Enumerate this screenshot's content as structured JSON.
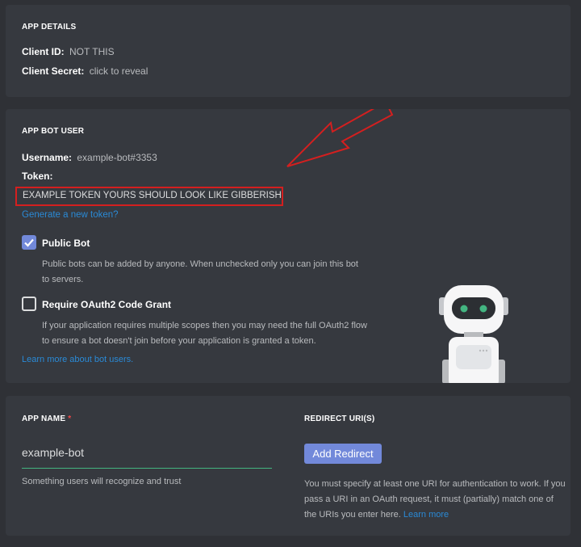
{
  "app_details": {
    "title": "APP DETAILS",
    "client_id_label": "Client ID:",
    "client_id_value": "NOT THIS",
    "client_secret_label": "Client Secret:",
    "client_secret_link": "click to reveal"
  },
  "bot_user": {
    "title": "APP BOT USER",
    "username_label": "Username:",
    "username_value": "example-bot#3353",
    "token_label": "Token:",
    "token_value": "EXAMPLE TOKEN YOURS SHOULD LOOK LIKE GIBBERISH",
    "new_token_link": "Generate a new token?",
    "public_bot": {
      "label": "Public Bot",
      "checked": true,
      "description": "Public bots can be added by anyone. When unchecked only you can join this bot to servers."
    },
    "oauth_grant": {
      "label": "Require OAuth2 Code Grant",
      "checked": false,
      "description": "If your application requires multiple scopes then you may need the full OAuth2 flow to ensure a bot doesn't join before your application is granted a token."
    },
    "learn_more_link": "Learn more about bot users.",
    "annotation_color": "#d41f1f"
  },
  "app_name": {
    "title": "APP NAME",
    "required_mark": "*",
    "value": "example-bot",
    "hint": "Something users will recognize and trust"
  },
  "redirect": {
    "title": "REDIRECT URI(S)",
    "button": "Add Redirect",
    "description": "You must specify at least one URI for authentication to work. If you pass a URI in an OAuth request, it must (partially) match one of the URIs you enter here.",
    "learn_more": "Learn more"
  },
  "colors": {
    "background": "#2f3136",
    "card": "#36393f",
    "blurple": "#7289da",
    "link": "#2a8ad6",
    "input_focus": "#43b581"
  }
}
